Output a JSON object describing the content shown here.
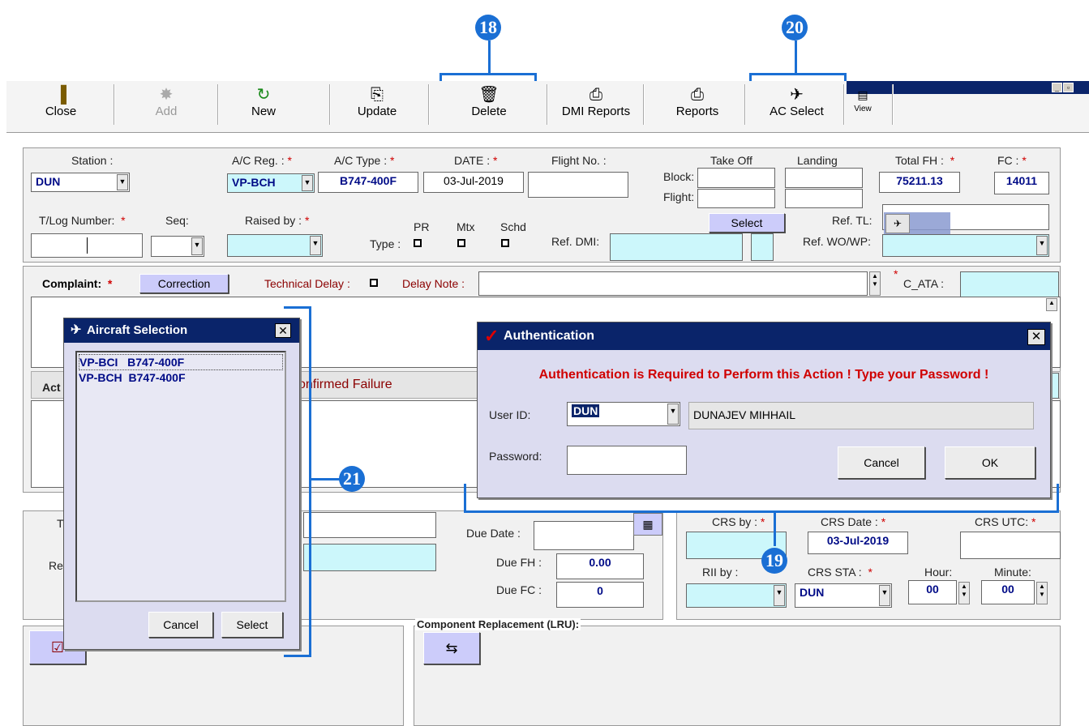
{
  "callouts": {
    "c18": "18",
    "c19": "19",
    "c20": "20",
    "c21": "21"
  },
  "toolbar": {
    "close": "Close",
    "add": "Add",
    "new": "New",
    "update": "Update",
    "delete": "Delete",
    "dmi_reports": "DMI Reports",
    "reports": "Reports",
    "ac_select": "AC Select",
    "view": "View"
  },
  "header": {
    "station_label": "Station :",
    "station_value": "DUN",
    "acreg_label": "A/C Reg. :",
    "acreg_value": "VP-BCH",
    "actype_label": "A/C Type :",
    "actype_value": "B747-400F",
    "date_label": "DATE :",
    "date_value": "03-Jul-2019",
    "flightno_label": "Flight No. :",
    "takeoff_label": "Take Off",
    "landing_label": "Landing",
    "block_label": "Block:",
    "flight_label": "Flight:",
    "totalfh_label": "Total FH :",
    "totalfh_value": "75211.13",
    "fc_label": "FC :",
    "fc_value": "14011",
    "tlog_label": "T/Log Number:",
    "seq_label": "Seq:",
    "raisedby_label": "Raised by :",
    "pr_label": "PR",
    "mtx_label": "Mtx",
    "schd_label": "Schd",
    "type_label": "Type :",
    "select_label": "Select",
    "refdmi_label": "Ref. DMI:",
    "reftl_label": "Ref. TL:",
    "refwo_label": "Ref. WO/WP:"
  },
  "complaint": {
    "label": "Complaint:",
    "correction": "Correction",
    "tech_delay": "Technical Delay :",
    "delay_note": "Delay Note :",
    "c_ata": "C_ATA :"
  },
  "action": {
    "label_partial": "Act",
    "confirmed": "confirmed Failure"
  },
  "lower": {
    "t_partial": "T",
    "re_partial": "Re",
    "due_date": "Due Date :",
    "due_fh": "Due FH :",
    "due_fh_value": "0.00",
    "due_fc": "Due FC :",
    "due_fc_value": "0",
    "crs_by": "CRS by :",
    "crs_date": "CRS Date :",
    "crs_date_value": "03-Jul-2019",
    "crs_utc": "CRS UTC:",
    "rii_by": "RII by :",
    "crs_sta": "CRS STA :",
    "crs_sta_value": "DUN",
    "hour": "Hour:",
    "hour_value": "00",
    "minute": "Minute:",
    "minute_value": "00",
    "component_replacement": "Component Replacement (LRU):"
  },
  "aircraft_dialog": {
    "title": "Aircraft Selection",
    "rows": [
      {
        "reg": "VP-BCI",
        "type": "B747-400F"
      },
      {
        "reg": "VP-BCH",
        "type": "B747-400F"
      }
    ],
    "cancel": "Cancel",
    "select": "Select"
  },
  "auth_dialog": {
    "title": "Authentication",
    "message": "Authentication is Required to Perform this Action ! Type your Password !",
    "user_id_label": "User ID:",
    "user_id_value": "DUN",
    "user_name": "DUNAJEV MIHHAIL",
    "password_label": "Password:",
    "cancel": "Cancel",
    "ok": "OK"
  },
  "colors": {
    "callout": "#1a6fd4",
    "titlebar": "#0a246a",
    "required": "#d00000",
    "cyan_field": "#ccf7fb",
    "dialog_bg": "#dcdcf0"
  }
}
